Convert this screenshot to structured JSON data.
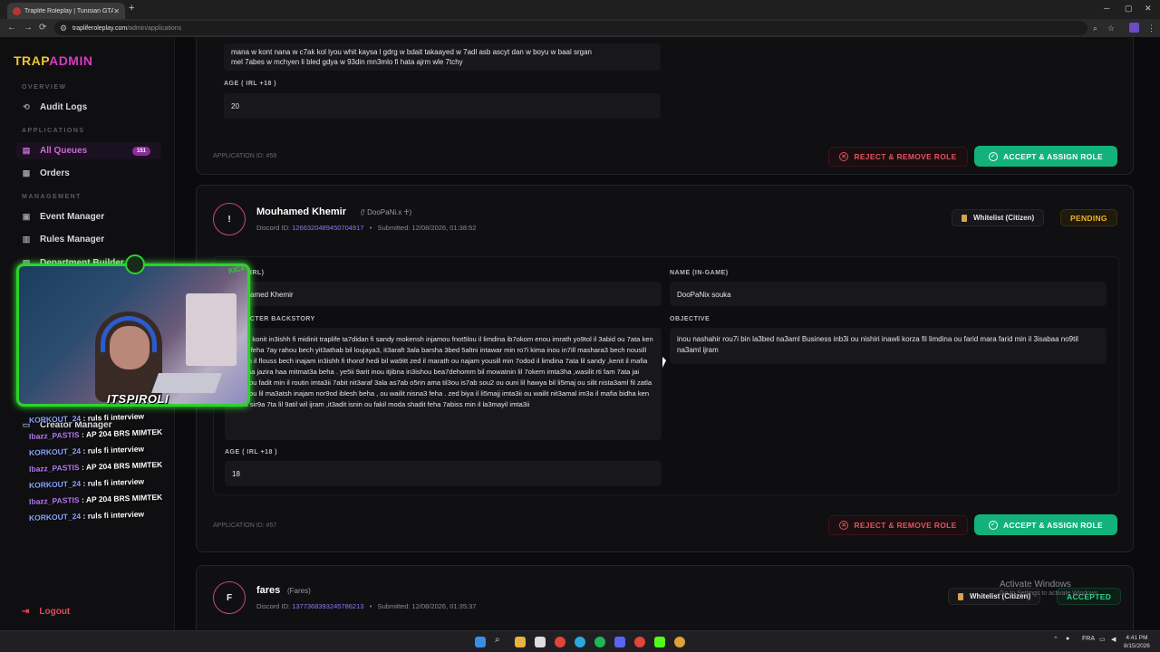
{
  "browser": {
    "tab_title": "Traplife Roleplay | Tunisian GTA",
    "url_host": "trapliferoleplay.com",
    "url_path": "/admin/applications"
  },
  "sidebar": {
    "logo_a": "TRAP",
    "logo_b": "ADMIN",
    "sections": {
      "overview": "OVERVIEW",
      "applications": "APPLICATIONS",
      "management": "MANAGEMENT"
    },
    "items": [
      {
        "label": "Audit Logs",
        "icon": "history-icon"
      },
      {
        "label": "All Queues",
        "icon": "queue-icon",
        "badge": "151"
      },
      {
        "label": "Orders",
        "icon": "orders-icon"
      },
      {
        "label": "Event Manager",
        "icon": "calendar-icon"
      },
      {
        "label": "Rules Manager",
        "icon": "book-icon"
      },
      {
        "label": "Department Builder",
        "icon": "building-icon"
      },
      {
        "label": "Creator Manager",
        "icon": "creator-icon"
      }
    ],
    "logout": "Logout"
  },
  "overlay": {
    "streamer": "ITSPIROLI",
    "kick_label": "KICK",
    "chat": [
      {
        "user": "KORKOUT_24",
        "msg": ": ruls fi interview"
      },
      {
        "user": "Ibazz_PASTIS",
        "msg": ": AP 204 BRS MIMTEK"
      },
      {
        "user": "KORKOUT_24",
        "msg": ": ruls fi interview"
      },
      {
        "user": "Ibazz_PASTIS",
        "msg": ": AP 204 BRS MIMTEK"
      },
      {
        "user": "KORKOUT_24",
        "msg": ": ruls fi interview"
      },
      {
        "user": "Ibazz_PASTIS",
        "msg": ": AP 204 BRS MIMTEK"
      },
      {
        "user": "KORKOUT_24",
        "msg": ": ruls fi interview"
      }
    ]
  },
  "app58": {
    "top_text_1": "mana w kont nana w c7ak kol lyou whit kaysa l gdrg w bdait takaayed w 7adl asb ascyt dan w boyu w baal srgan",
    "top_text_2": "mel 7abes w mchyen li bled gdya w 93din mn3mlo fi hata ajrm wle 7tchy",
    "age_label": "AGE ( IRL +18 )",
    "age_value": "20",
    "app_id": "APPLICATION ID: #58"
  },
  "actions": {
    "reject": "REJECT & REMOVE ROLE",
    "accept": "ACCEPT & ASSIGN ROLE"
  },
  "app57": {
    "avatar": "!",
    "name": "Mouhamed Khemir",
    "alias": "(! DooPaNi.x ♰)",
    "discord_label": "Discord ID:",
    "discord_id": "1266320489450704917",
    "submitted": "Submitted: 12/08/2026, 01:38:52",
    "tag": "Whitelist (Citizen)",
    "status": "PENDING",
    "name_irl_label": "NAME (IRL)",
    "name_irl_value": "Mouhamed Khemir",
    "name_game_label": "NAME (IN-GAME)",
    "name_game_value": "DooPaNix souka",
    "backstory_label": "CHARACTER BACKSTORY",
    "backstory": "olpani konit in3ishh fi midinit traplife ta7didan fi sandy mokensh injamou fnot5lou il limdina ib7okom enou imrath yo9tol il 3abid ou 7ata ken i9a3d feha 7ay rahou bech yit3athab bil loujaya3, it3araft 3ala barsha 3bed 5altni intawar min ro7i kima inou in7ill mashara3 bech nousill inilmm il flouss bech inajam in3ishh fi thorof hedi bil wa9itt zed il marath ou najam yousill min 7odod il limdina 7ata lil sandy ,kenit il mafia 3andha jazira haa mitmat3a beha . ye5ii 9arit inou itjibna in3ishou bea7dehomm bil mowatnin lil 7okem imta3ha ,wasilit rti fam 7ata jai inahr ou fadit min il routin imta3ii 7abit nit3araf 3ala as7ab o5rin ama til3ou is7ab sou2 ou ouni lil hawya bil li5maj ou silit nista3aml fil zatla inhar ou lil ma3atsh inajam nor9od iblesh beha , ou wailit nisna3 feha . zed biya il li5majj imta3ii ou wailit nit3amal im3a il mafia bidha ken min il sir9a 7ta lil 9atil wil ijram ,it3adit isnin ou fakil moda shadit feha 7abiss min il la3mayil imta3ii",
    "objective_label": "OBJECTIVE",
    "objective": "inou nashahir rou7i bin la3bed na3aml Business inb3i ou nishiri inawli korza fil limdina ou farid mara farid min il 3isabaa no9til na3aml ijram",
    "age_label": "AGE ( IRL +18 )",
    "age_value": "18",
    "app_id": "APPLICATION ID: #57"
  },
  "app56": {
    "avatar": "F",
    "name": "fares",
    "alias": "(Fares)",
    "discord_label": "Discord ID:",
    "discord_id": "1377368393245786213",
    "submitted": "Submitted: 12/08/2026, 01:35:37",
    "tag": "Whitelist (Citizen)",
    "status": "ACCEPTED"
  },
  "watermark": {
    "line1": "Activate Windows",
    "line2": "Go to Settings to activate Windows."
  },
  "taskbar": {
    "lang": "FRA",
    "time": "4:41 PM",
    "date": "8/15/2026"
  },
  "colors": {
    "accent": "#c96ad6",
    "logo_yellow": "#f0c330",
    "logo_pink": "#d63ac2",
    "accept": "#12b27a",
    "reject": "#e3525e",
    "pending": "#f0b429"
  }
}
